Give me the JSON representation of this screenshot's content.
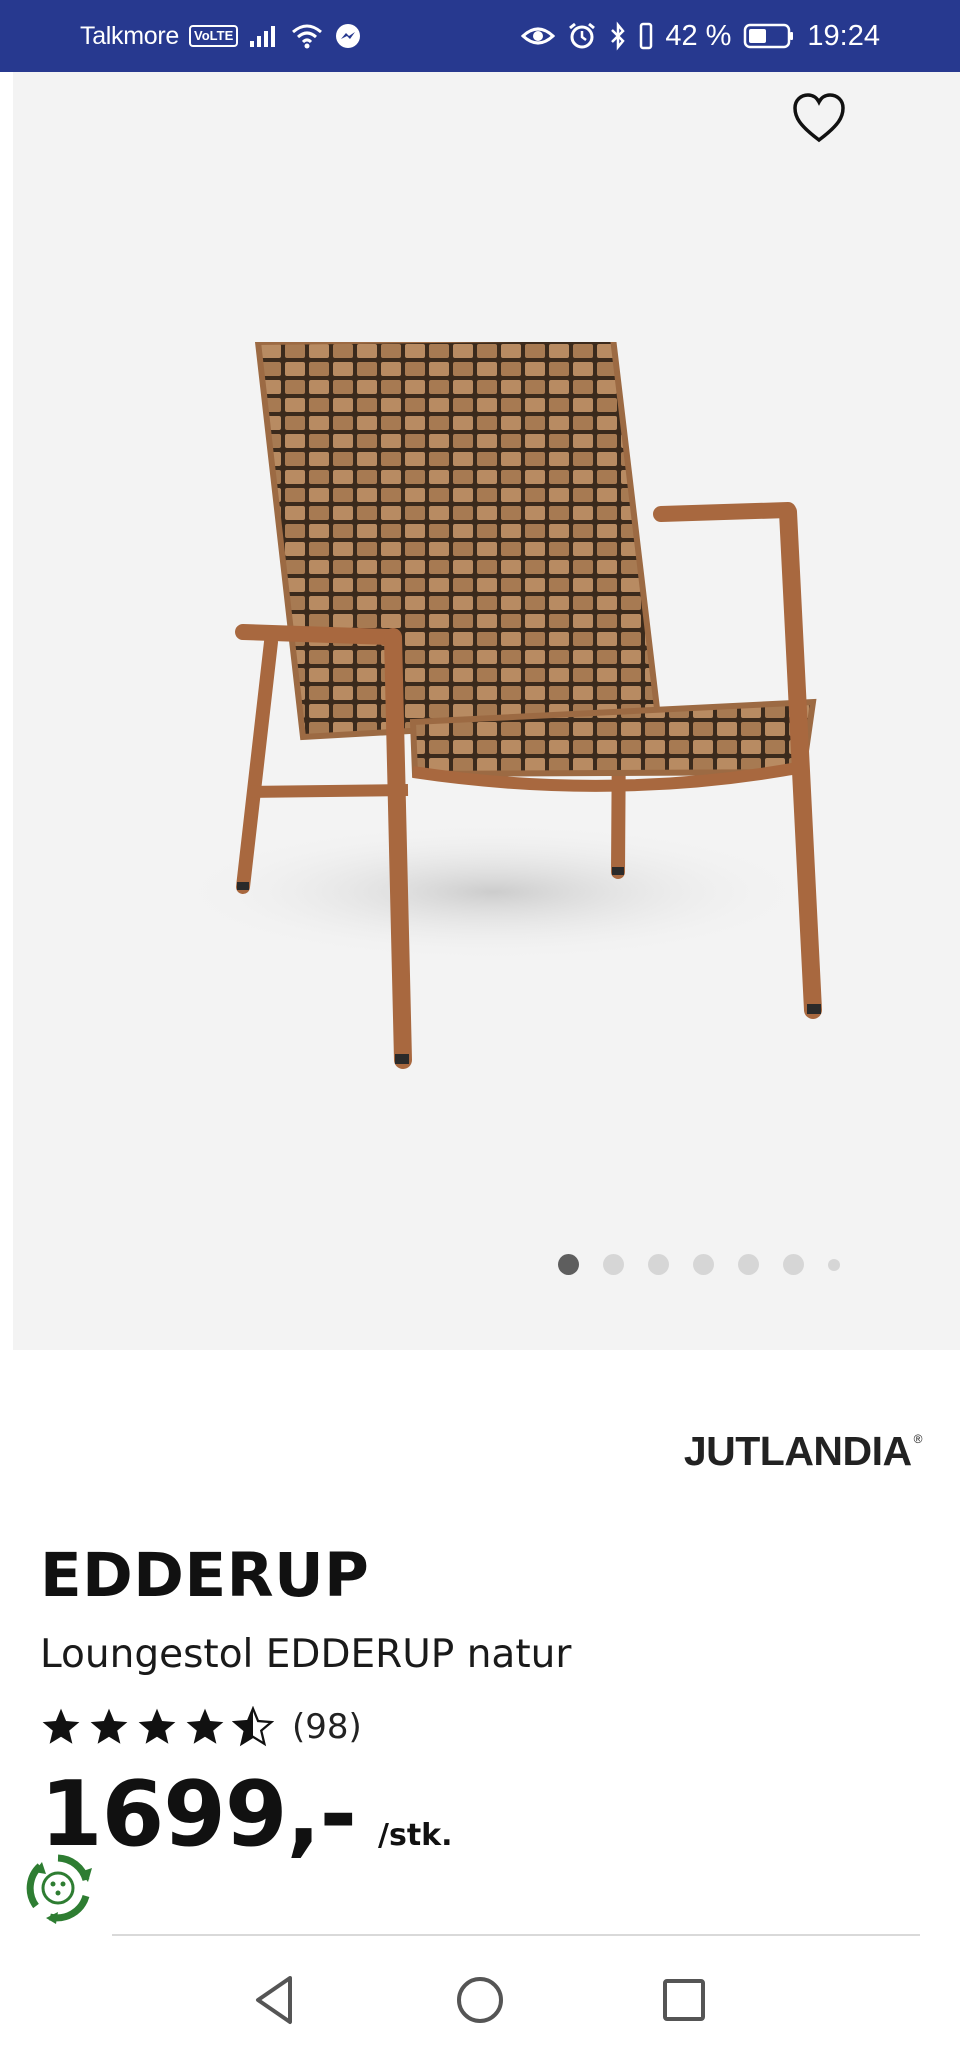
{
  "status_bar": {
    "carrier": "Talkmore",
    "volte": "VoLTE",
    "battery_percent": "42 %",
    "time": "19:24",
    "icons": [
      "signal-icon",
      "wifi-icon",
      "messenger-icon",
      "eye-icon",
      "alarm-icon",
      "bluetooth-icon",
      "vibrate-icon",
      "battery-icon"
    ]
  },
  "gallery": {
    "favorite_icon": "heart-outline-icon",
    "image_count": 7,
    "active_index": 0
  },
  "product": {
    "brand": "JUTLANDIA",
    "brand_mark": "®",
    "name": "EDDERUP",
    "description": "Loungestol EDDERUP natur",
    "rating": 4.5,
    "rating_max": 5,
    "review_count": "(98)",
    "price": "1699,-",
    "price_unit": "/stk."
  },
  "badge": {
    "icon": "eco-recycle-icon",
    "color": "#2e7d32"
  },
  "nav": {
    "back_icon": "back-triangle-icon",
    "home_icon": "home-circle-icon",
    "recents_icon": "recents-square-icon"
  },
  "colors": {
    "status_bar_bg": "#27398f",
    "gallery_bg": "#f3f3f3",
    "chair_wood": "#a8683f",
    "chair_strap": "#b0835a"
  }
}
